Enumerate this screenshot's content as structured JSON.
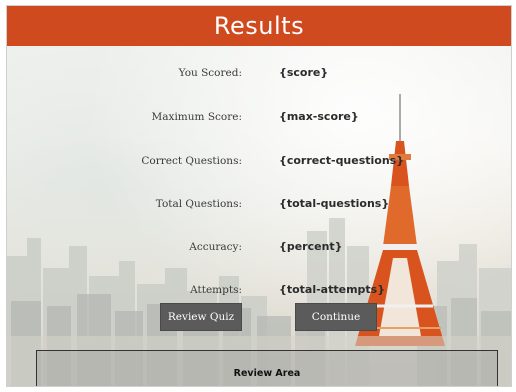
{
  "header": {
    "title": "Results"
  },
  "results": [
    {
      "label": "You Scored:",
      "value": "{score}"
    },
    {
      "label": "Maximum Score:",
      "value": "{max-score}"
    },
    {
      "label": "Correct Questions:",
      "value": "{correct-questions}"
    },
    {
      "label": "Total Questions:",
      "value": "{total-questions}"
    },
    {
      "label": "Accuracy:",
      "value": "{percent}"
    },
    {
      "label": "Attempts:",
      "value": "{total-attempts}"
    }
  ],
  "buttons": {
    "review": "Review Quiz",
    "continue": "Continue"
  },
  "review_area": {
    "label": "Review Area"
  },
  "colors": {
    "header": "#d04a1f",
    "button": "#5b5b5b",
    "tower": "#d9531e"
  }
}
